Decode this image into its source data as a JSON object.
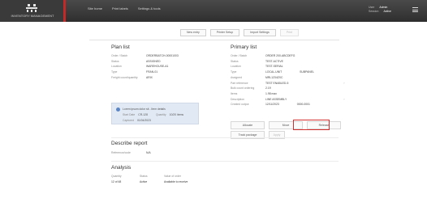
{
  "header": {
    "logo_text": "INVENTORY MANAGEMENT",
    "nav": [
      "Site home",
      "Print labels",
      "Settings & tools"
    ],
    "user": {
      "label1": "User",
      "value1": "Admin",
      "label2": "Session",
      "value2": "Active"
    }
  },
  "toolbar": [
    "New entry",
    "Printer Setup",
    "Import Settings",
    "Print"
  ],
  "left": {
    "title": "Plan list",
    "rows": [
      {
        "k": "Order / Batch",
        "v": "ORDERBATCH-00001003"
      },
      {
        "k": "Status",
        "v": "ASSIGNED"
      },
      {
        "k": "Location",
        "v": "WAREHOUSE-A1"
      },
      {
        "k": "Type",
        "v": "FRAN-01"
      },
      {
        "k": "Freight count/quantity",
        "v": "ARIX"
      }
    ],
    "info": {
      "line1": "Lorem ipsum dolor sit - Item details",
      "line2_tag": "Start Date",
      "line2_val": "CR-128",
      "line2_tag2": "Quantity",
      "line2_val2": "10/20 items",
      "line3_tag": "Captured",
      "line3_val": "01/04/2023"
    }
  },
  "right": {
    "title": "Primary list",
    "rows": [
      {
        "k": "Order / Batch",
        "v": "ORDER 200-ABCDEFG",
        "v2": "",
        "dot": ""
      },
      {
        "k": "Status",
        "v": "TEST-ACTIVE",
        "v2": "",
        "dot": ""
      },
      {
        "k": "Location",
        "v": "TEST-SERIAL",
        "v2": "",
        "dot": ""
      },
      {
        "k": "Type",
        "v": "LOCAL-UNIT",
        "v2": "SUBPANEL",
        "dot": ""
      },
      {
        "k": "Assigned",
        "v": "MRL1234ZXC",
        "v2": "",
        "dot": ""
      },
      {
        "k": "Part reference",
        "v": "TEST ENABLED-5",
        "v2": "",
        "dot": "›"
      },
      {
        "k": "Bulk count ordering",
        "v": "2.19",
        "v2": "",
        "dot": ""
      },
      {
        "k": "Items",
        "v": "1.98 max",
        "v2": "",
        "dot": ""
      },
      {
        "k": "Description",
        "v": "LINE ASSEMBLY",
        "v2": "",
        "dot": "›"
      },
      {
        "k": "Created output",
        "v": "12/11/2023",
        "v2": "0000-0001",
        "dot": ""
      }
    ],
    "buttons": [
      "Allocate",
      "Move",
      "Release"
    ],
    "buttons2": [
      "Track package",
      "Apply"
    ]
  },
  "dc": {
    "title": "Describe report",
    "rows": [
      {
        "k": "Reference/code",
        "v": "N/A"
      }
    ]
  },
  "analysis": {
    "title": "Analysis",
    "headers": [
      "Quantity",
      "Status",
      "Value of order"
    ],
    "values": [
      "12 of 48",
      "Active",
      "Available to receive"
    ]
  }
}
